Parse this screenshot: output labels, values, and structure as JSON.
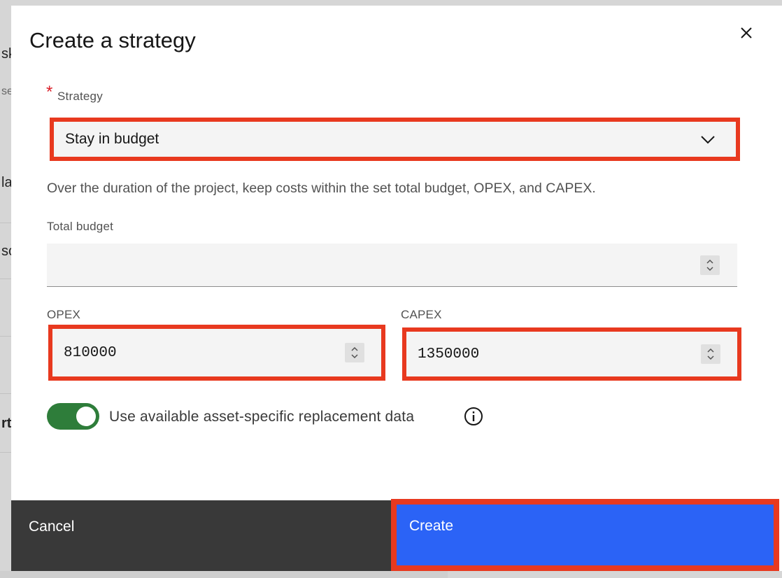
{
  "background": {
    "fragments": [
      "sk",
      "se",
      "la",
      "sc",
      "rt"
    ]
  },
  "modal": {
    "title": "Create a strategy",
    "close_icon": "close-icon"
  },
  "strategy": {
    "required_mark": "*",
    "label": "Strategy",
    "selected": "Stay in budget",
    "description": "Over the duration of the project, keep costs within the set total budget, OPEX, and CAPEX."
  },
  "total_budget": {
    "label": "Total budget",
    "value": ""
  },
  "opex": {
    "label": "OPEX",
    "value": "810000"
  },
  "capex": {
    "label": "CAPEX",
    "value": "1350000"
  },
  "replacement_toggle": {
    "label": "Use available asset-specific replacement data",
    "on": true
  },
  "footer": {
    "cancel_label": "Cancel",
    "create_label": "Create"
  },
  "colors": {
    "primary": "#2b63f6",
    "highlight": "#e8391f",
    "toggle_on": "#2e7d3a",
    "secondary_button": "#393939"
  }
}
